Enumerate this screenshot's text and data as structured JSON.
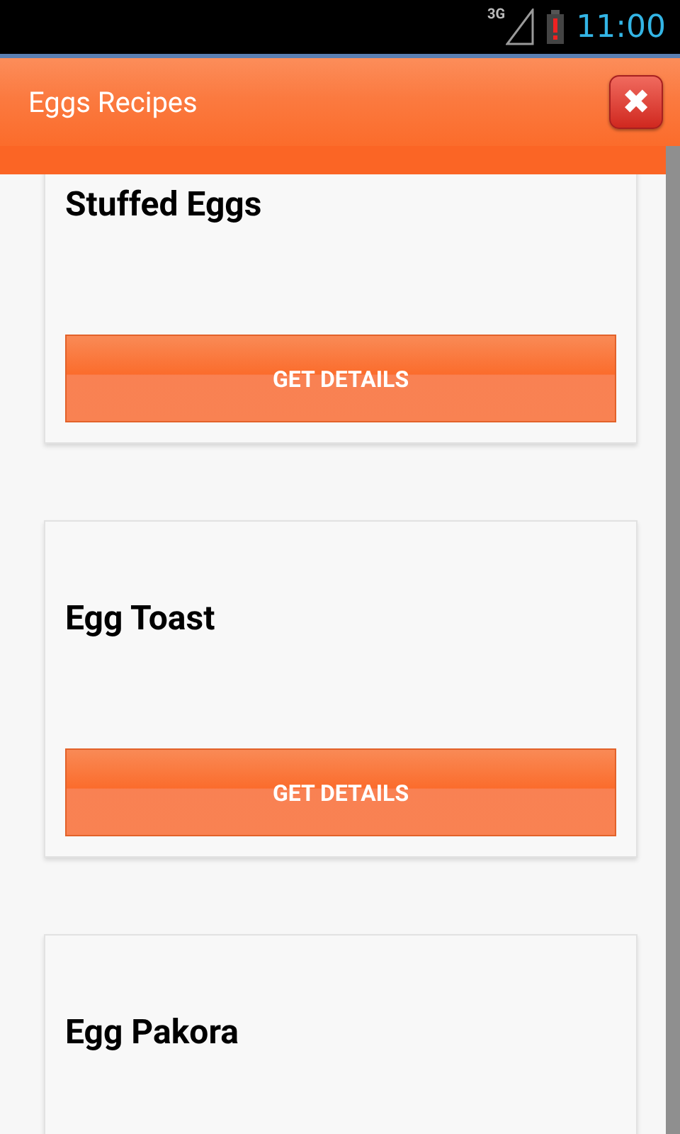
{
  "status_bar": {
    "network": "3G",
    "time": "11:00"
  },
  "action_bar": {
    "title": "Eggs Recipes",
    "close_icon": "✖"
  },
  "recipes": [
    {
      "title": "Stuffed Eggs",
      "button": "GET DETAILS"
    },
    {
      "title": "Egg Toast",
      "button": "GET DETAILS"
    },
    {
      "title": "Egg Pakora"
    }
  ]
}
